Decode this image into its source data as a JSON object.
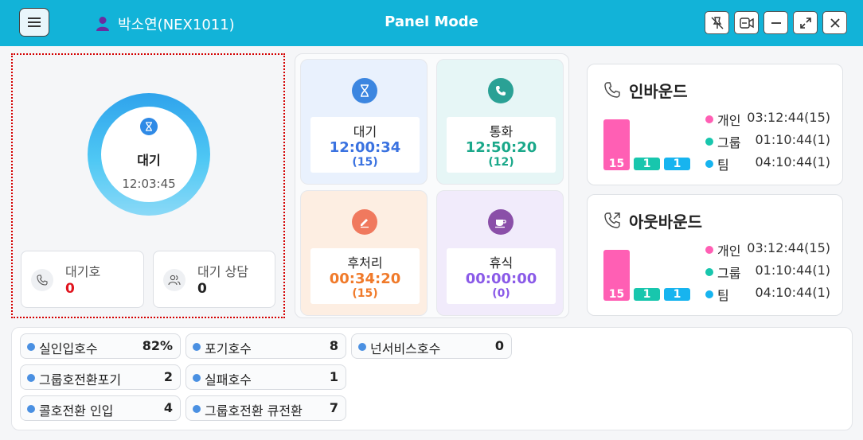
{
  "titlebar": {
    "user_name": "박소연(NEX1011)",
    "app_title": "Panel Mode",
    "buttons": [
      "pin-off-icon",
      "video-icon",
      "minimize-icon",
      "expand-icon",
      "close-icon"
    ]
  },
  "status": {
    "label": "대기",
    "time": "12:03:45",
    "queue_calls_label": "대기호",
    "queue_calls_value": "0",
    "waiting_consult_label": "대기 상담",
    "waiting_consult_value": "0"
  },
  "states": [
    {
      "name": "대기",
      "time": "12:00:34",
      "count": "(15)",
      "color": "#3a72e0",
      "icon": "hourglass-icon"
    },
    {
      "name": "통화",
      "time": "12:50:20",
      "count": "(12)",
      "color": "#1aa88a",
      "icon": "phone-icon"
    },
    {
      "name": "후처리",
      "time": "00:34:20",
      "count": "(15)",
      "color": "#f07a2a",
      "icon": "pen-icon"
    },
    {
      "name": "휴식",
      "time": "00:00:00",
      "count": "(0)",
      "color": "#8a5ae8",
      "icon": "coffee-icon"
    }
  ],
  "inbound": {
    "title": "인바운드",
    "bars": [
      {
        "value": 15,
        "label": "15",
        "color": "#ff5fb4"
      },
      {
        "value": 1,
        "label": "1",
        "color": "#18c6ad"
      },
      {
        "value": 1,
        "label": "1",
        "color": "#17b4ef"
      }
    ],
    "legend": [
      {
        "label": "개인",
        "time": "03:12:44(15)",
        "color": "#ff5fb4"
      },
      {
        "label": "그룹",
        "time": "01:10:44(1)",
        "color": "#18c6ad"
      },
      {
        "label": "팀",
        "time": "04:10:44(1)",
        "color": "#17b4ef"
      }
    ]
  },
  "outbound": {
    "title": "아웃바운드",
    "bars": [
      {
        "value": 15,
        "label": "15",
        "color": "#ff5fb4"
      },
      {
        "value": 1,
        "label": "1",
        "color": "#18c6ad"
      },
      {
        "value": 1,
        "label": "1",
        "color": "#17b4ef"
      }
    ],
    "legend": [
      {
        "label": "개인",
        "time": "03:12:44(15)",
        "color": "#ff5fb4"
      },
      {
        "label": "그룹",
        "time": "01:10:44(1)",
        "color": "#18c6ad"
      },
      {
        "label": "팀",
        "time": "04:10:44(1)",
        "color": "#17b4ef"
      }
    ]
  },
  "stats": [
    {
      "label": "실인입호수",
      "value": "82%"
    },
    {
      "label": "포기호수",
      "value": "8"
    },
    {
      "label": "넌서비스호수",
      "value": "0"
    },
    {
      "label": "그룹호전환포기",
      "value": "2"
    },
    {
      "label": "실패호수",
      "value": "1"
    },
    {
      "label": "콜호전환 인입",
      "value": "4"
    },
    {
      "label": "그룹호전환 큐전환",
      "value": "7"
    }
  ]
}
